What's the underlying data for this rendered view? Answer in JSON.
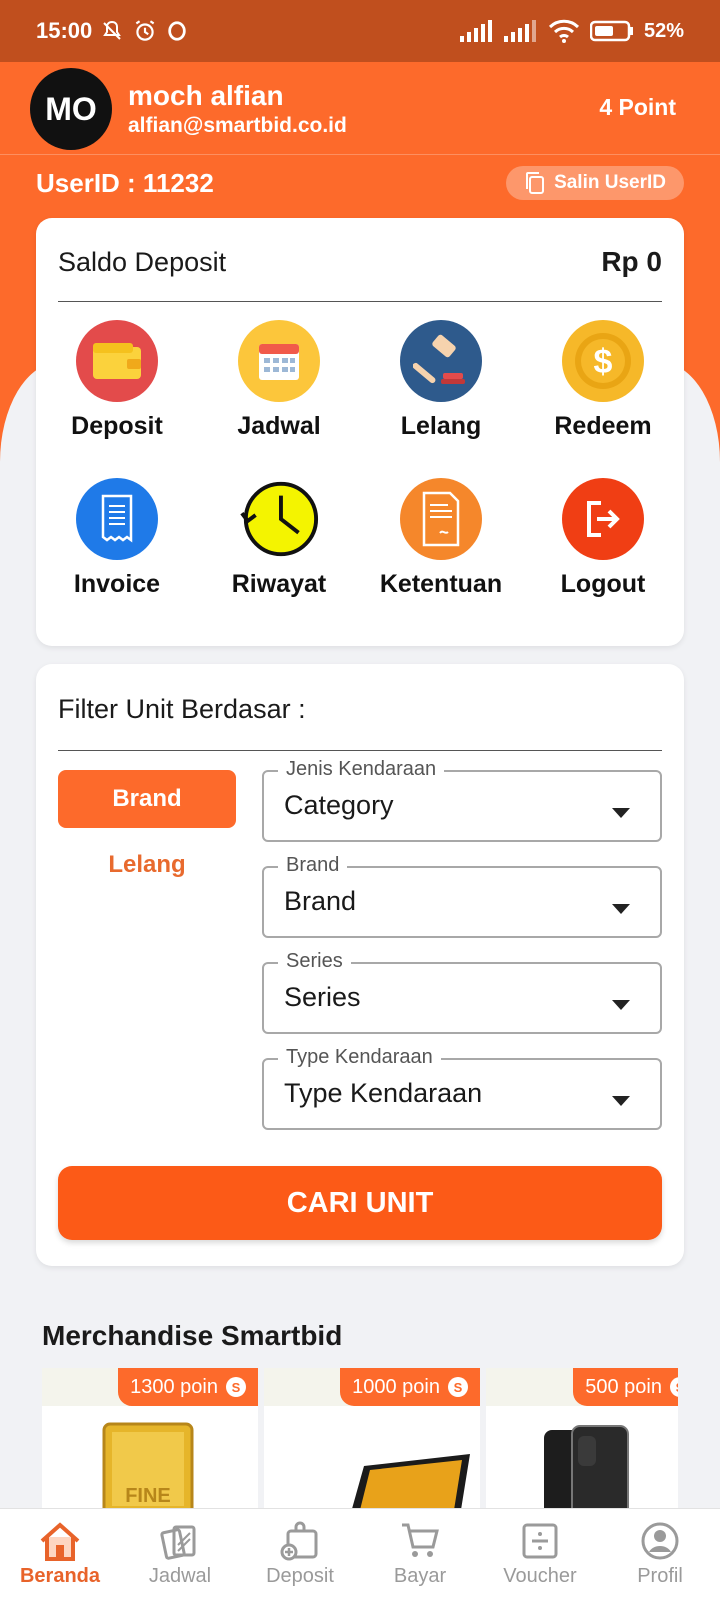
{
  "status_bar": {
    "time": "15:00",
    "battery": "52%"
  },
  "profile": {
    "initials": "MO",
    "name": "moch alfian",
    "email": "alfian@smartbid.co.id",
    "points": "4 Point",
    "user_id": "UserID : 11232",
    "copy_label": "Salin UserID"
  },
  "saldo": {
    "label": "Saldo Deposit",
    "value": "Rp 0"
  },
  "menu": {
    "items": [
      {
        "label": "Deposit",
        "icon": "wallet-icon",
        "color": "#e34b4b"
      },
      {
        "label": "Jadwal",
        "icon": "calendar-icon",
        "color": "#fcc63b"
      },
      {
        "label": "Lelang",
        "icon": "gavel-icon",
        "color": "#2e5a8c"
      },
      {
        "label": "Redeem",
        "icon": "coin-icon",
        "color": "#f6b829"
      },
      {
        "label": "Invoice",
        "icon": "receipt-icon",
        "color": "#1f7ae8"
      },
      {
        "label": "Riwayat",
        "icon": "history-clock-icon",
        "color": "#f4f400"
      },
      {
        "label": "Ketentuan",
        "icon": "document-icon",
        "color": "#f5872b"
      },
      {
        "label": "Logout",
        "icon": "logout-icon",
        "color": "#f03e14"
      }
    ]
  },
  "filter": {
    "title": "Filter Unit Berdasar :",
    "tab_active": "Brand",
    "tab_inactive": "Lelang",
    "fields": [
      {
        "label": "Jenis Kendaraan",
        "value": "Category"
      },
      {
        "label": "Brand",
        "value": "Brand"
      },
      {
        "label": "Series",
        "value": "Series"
      },
      {
        "label": "Type Kendaraan",
        "value": "Type Kendaraan"
      }
    ],
    "search_button": "CARI UNIT"
  },
  "merchandise": {
    "title": "Merchandise Smartbid",
    "items": [
      {
        "poin": "1300 poin",
        "icon": "gold-bar-icon"
      },
      {
        "poin": "1000 poin",
        "icon": "laptop-icon"
      },
      {
        "poin": "500 poin",
        "icon": "phone-icon"
      }
    ]
  },
  "bottom_nav": {
    "items": [
      {
        "label": "Beranda",
        "icon": "home-icon",
        "active": true
      },
      {
        "label": "Jadwal",
        "icon": "cards-icon"
      },
      {
        "label": "Deposit",
        "icon": "bag-plus-icon"
      },
      {
        "label": "Bayar",
        "icon": "cart-icon"
      },
      {
        "label": "Voucher",
        "icon": "voucher-icon"
      },
      {
        "label": "Profil",
        "icon": "user-icon"
      }
    ]
  },
  "colors": {
    "accent": "#fd6a2b",
    "status_bar": "#c04f1e"
  }
}
